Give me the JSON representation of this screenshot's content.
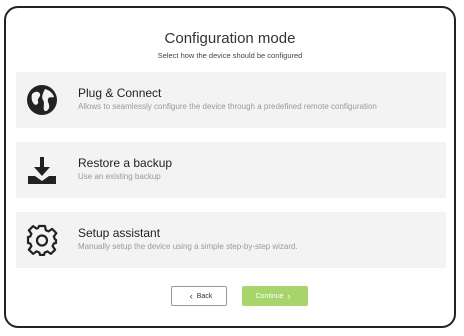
{
  "header": {
    "title": "Configuration mode",
    "subtitle": "Select how the device should be configured"
  },
  "options": [
    {
      "label": "Plug & Connect",
      "description": "Allows to seamlessly configure the device through a predefined remote configuration",
      "icon": "globe-icon"
    },
    {
      "label": "Restore a backup",
      "description": "Use an existing backup",
      "icon": "download-tray-icon"
    },
    {
      "label": "Setup assistant",
      "description": "Manually setup the device using a simple step-by-step wizard.",
      "icon": "gear-icon"
    }
  ],
  "footer": {
    "back_label": "Back",
    "continue_label": "Continue",
    "continue_color": "#a7d56c"
  }
}
